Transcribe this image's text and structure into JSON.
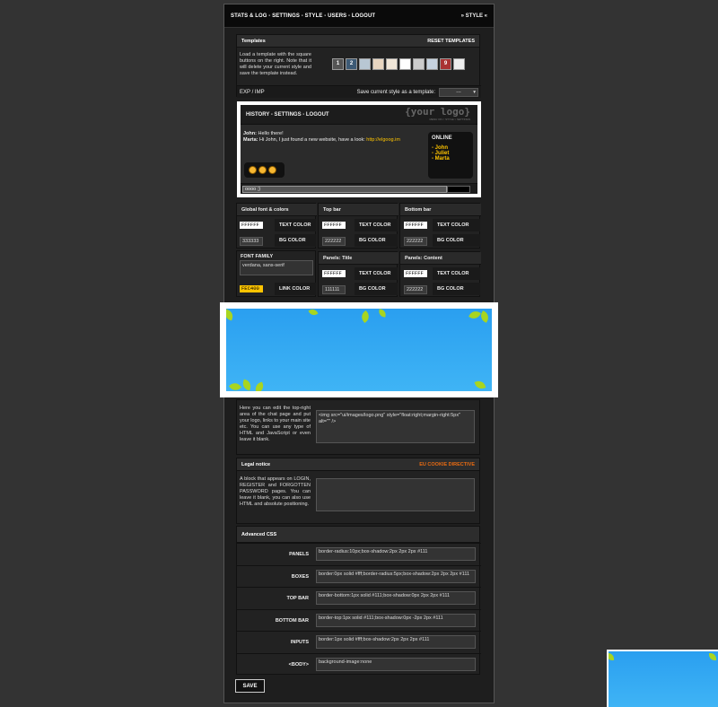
{
  "topbar": {
    "nav": "STATS & LOG - SETTINGS - STYLE - USERS - LOGOUT",
    "right": "» STYLE «"
  },
  "templates": {
    "title": "Templates",
    "reset": "RESET TEMPLATES",
    "desc": "Load a template with the square buttons on the right. Note that it will delete your current style and save the template instead.",
    "buttons": [
      "1",
      "2",
      "3",
      "4",
      "5",
      "6",
      "7",
      "8",
      "9",
      "10"
    ],
    "colors": [
      "#555",
      "#3d5a75",
      "#b8c7d3",
      "#e8d5c0",
      "#f0e6d8",
      "#fff",
      "#ccc",
      "#c6d3e0",
      "#a33",
      "#eee"
    ],
    "exp": "EXP / IMP",
    "save_label": "Save current style as a template:",
    "save_select": "---"
  },
  "preview": {
    "nav": "HISTORY - SETTINGS - LOGOUT",
    "logo": "{your logo}",
    "logo_sub": "MENU ON < STYLE > SETTINGS",
    "msg1_user": "John:",
    "msg1_text": "Hello there!",
    "msg2_user": "Marta:",
    "msg2_text": "Hi John, I just found a new website, have a look:",
    "msg2_link": "http://elgoog.im",
    "online_title": "ONLINE",
    "online_users": [
      "- John",
      "- Juliet",
      "- Marta"
    ],
    "input_value": "oooo ;)"
  },
  "global": {
    "title": "Global font & colors",
    "text_val": "FFFFFF",
    "text_lbl": "TEXT COLOR",
    "bg_val": "333333",
    "bg_lbl": "BG COLOR",
    "font_lbl": "FONT FAMILY",
    "font_val": "verdana, sans-serif",
    "link_val": "FEC400",
    "link_lbl": "LINK COLOR"
  },
  "topbarcfg": {
    "title": "Top bar",
    "text_val": "FFFFFF",
    "text_lbl": "TEXT COLOR",
    "bg_val": "222222",
    "bg_lbl": "BG COLOR"
  },
  "bottombar": {
    "title": "Bottom bar",
    "text_val": "FFFFFF",
    "text_lbl": "TEXT COLOR",
    "bg_val": "222222",
    "bg_lbl": "BG COLOR"
  },
  "ptitle": {
    "title": "Panels: Title",
    "text_val": "FFFFFF",
    "text_lbl": "TEXT COLOR",
    "bg_val": "111111",
    "bg_lbl": "BG COLOR"
  },
  "pcontent": {
    "title": "Panels: Content",
    "text_val": "FFFFFF",
    "text_lbl": "TEXT COLOR",
    "bg_val": "222222",
    "bg_lbl": "BG COLOR"
  },
  "logo_panel": {
    "desc": "Here you can edit the top-right area of the chat page and put your logo, links to your main site etc. You can use any type of HTML and JavaScript or even leave it blank.",
    "code": "<img src=\"ui/images/logo.png\" style=\"float:right;margin-right:5px\" alt=\"\" />"
  },
  "legal": {
    "title": "Legal notice",
    "link": "EU COOKIE DIRECTIVE",
    "desc": "A block that appears on LOGIN, REGISTER and FORGOTTEN PASSWORD pages. You can leave it blank, you can also use HTML and absolute positioning."
  },
  "advanced": {
    "title": "Advanced CSS",
    "rows": [
      {
        "label": "PANELS",
        "value": "border-radius:10px;box-shadow:2px 2px 2px #111"
      },
      {
        "label": "BOXES",
        "value": "border:0px solid #fff;border-radius:5px;box-shadow:2px 2px 2px #111"
      },
      {
        "label": "TOP BAR",
        "value": "border-bottom:1px solid #111;box-shadow:0px 2px 2px #111"
      },
      {
        "label": "BOTTOM BAR",
        "value": "border-top:1px solid #111;box-shadow:0px -2px 2px #111"
      },
      {
        "label": "INPUTS",
        "value": "border:1px solid #fff;box-shadow:2px 2px 2px #111"
      },
      {
        "label": "<BODY>",
        "value": "background-image:none"
      }
    ]
  },
  "save": "SAVE"
}
